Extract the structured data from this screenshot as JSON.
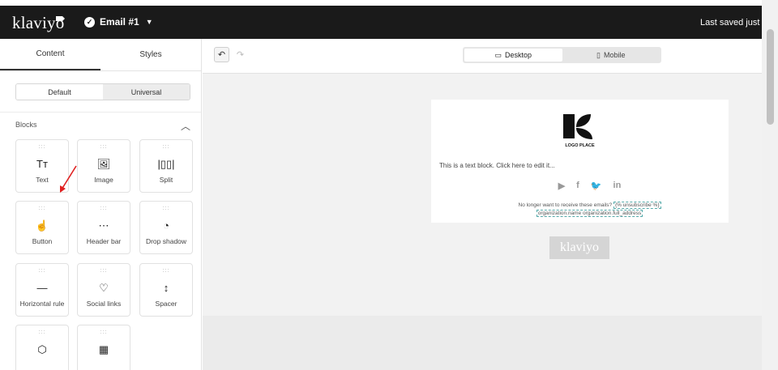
{
  "header": {
    "brand": "klaviyo",
    "email_name": "Email #1",
    "last_saved": "Last saved just no"
  },
  "sidebar": {
    "tabs": [
      {
        "label": "Content"
      },
      {
        "label": "Styles"
      }
    ],
    "segment": [
      {
        "label": "Default"
      },
      {
        "label": "Universal"
      }
    ],
    "blocks_title": "Blocks",
    "blocks": [
      {
        "label": "Text",
        "icon": "Tт"
      },
      {
        "label": "Image",
        "icon": "🖼"
      },
      {
        "label": "Split",
        "icon": "|▯▯|"
      },
      {
        "label": "Button",
        "icon": "☝"
      },
      {
        "label": "Header bar",
        "icon": "⋯"
      },
      {
        "label": "Drop shadow",
        "icon": "◔"
      },
      {
        "label": "Horizontal rule",
        "icon": "—"
      },
      {
        "label": "Social links",
        "icon": "♡"
      },
      {
        "label": "Spacer",
        "icon": "↕"
      },
      {
        "label": "",
        "icon": "⬡"
      },
      {
        "label": "",
        "icon": "▦"
      }
    ]
  },
  "toolbar": {
    "undo_icon": "↶",
    "redo_icon": "↷",
    "views": [
      {
        "label": "Desktop",
        "icon": "▭"
      },
      {
        "label": "Mobile",
        "icon": "▯"
      }
    ]
  },
  "email": {
    "logo_caption": "LOGO PLACE",
    "text_block": "This is a text block. Click here to edit it...",
    "social_icons": [
      "▶",
      "f",
      "🐦",
      "in"
    ],
    "footer_line1_prefix": "No longer want to receive these emails?",
    "footer_unsubscribe_tag": "{% unsubscribe %}",
    "footer_line2": "organization.name organization.full_address"
  },
  "badge": "klaviyo",
  "colors": {
    "topbar": "#1a1a1a",
    "arrow": "#e02020"
  }
}
